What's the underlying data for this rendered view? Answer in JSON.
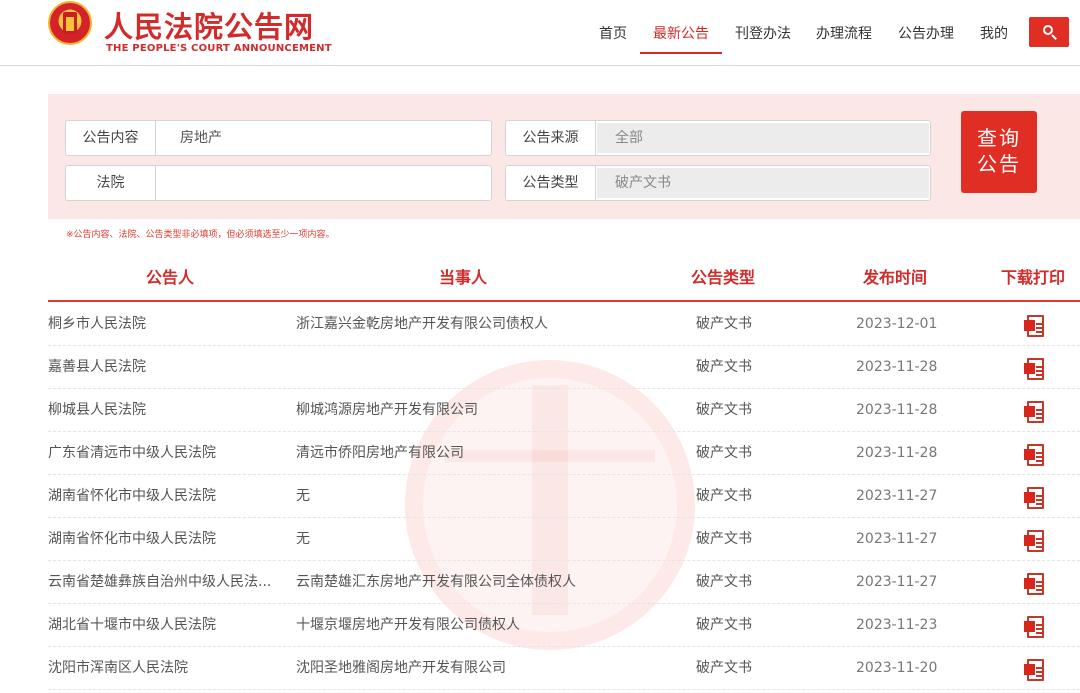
{
  "header": {
    "title": "人民法院公告网",
    "subtitle": "THE PEOPLE'S COURT ANNOUNCEMENT",
    "nav": [
      "首页",
      "最新公告",
      "刊登办法",
      "办理流程",
      "公告办理",
      "我的"
    ],
    "active_nav": "最新公告",
    "search_icon": "search-icon"
  },
  "search": {
    "content_label": "公告内容",
    "content_value": "房地产",
    "source_label": "公告来源",
    "source_value": "全部",
    "court_label": "法院",
    "court_value": "",
    "type_label": "公告类型",
    "type_value": "破产文书",
    "query_button_line1": "查询",
    "query_button_line2": "公告",
    "hint": "※公告内容、法院、公告类型非必填项，但必须填选至少一项内容。"
  },
  "table": {
    "headers": [
      "公告人",
      "当事人",
      "公告类型",
      "发布时间",
      "下载打印"
    ],
    "rows": [
      {
        "court": "桐乡市人民法院",
        "party": "浙江嘉兴金乾房地产开发有限公司债权人",
        "type": "破产文书",
        "date": "2023-12-01"
      },
      {
        "court": "嘉善县人民法院",
        "party": "",
        "type": "破产文书",
        "date": "2023-11-28"
      },
      {
        "court": "柳城县人民法院",
        "party": "柳城鸿源房地产开发有限公司",
        "type": "破产文书",
        "date": "2023-11-28"
      },
      {
        "court": "广东省清远市中级人民法院",
        "party": "清远市侨阳房地产有限公司",
        "type": "破产文书",
        "date": "2023-11-28"
      },
      {
        "court": "湖南省怀化市中级人民法院",
        "party": "无",
        "type": "破产文书",
        "date": "2023-11-27"
      },
      {
        "court": "湖南省怀化市中级人民法院",
        "party": "无",
        "type": "破产文书",
        "date": "2023-11-27"
      },
      {
        "court": "云南省楚雄彝族自治州中级人民法...",
        "party": "云南楚雄汇东房地产开发有限公司全体债权人",
        "type": "破产文书",
        "date": "2023-11-27"
      },
      {
        "court": "湖北省十堰市中级人民法院",
        "party": "十堰京堰房地产开发有限公司债权人",
        "type": "破产文书",
        "date": "2023-11-23"
      },
      {
        "court": "沈阳市浑南区人民法院",
        "party": "沈阳圣地雅阁房地产开发有限公司",
        "type": "破产文书",
        "date": "2023-11-20"
      }
    ],
    "download_icon": "pdf-icon"
  },
  "colors": {
    "brand_red": "#d22b2b",
    "button_red": "#e02e24",
    "panel_bg": "#fbe8e6"
  }
}
